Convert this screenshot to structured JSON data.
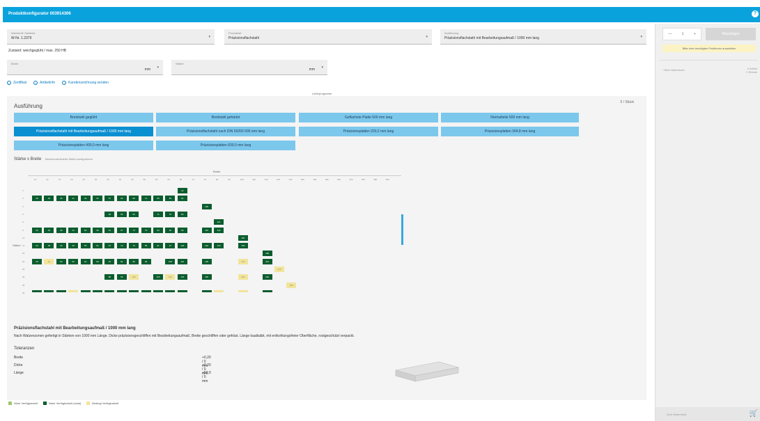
{
  "app": {
    "title": "Produktkonfigurator 003914306",
    "help_icon": "question-icon"
  },
  "selectors": {
    "material": {
      "label": "Werkstoff / Material",
      "value": "W-Nr. 1.2379"
    },
    "product": {
      "label": "Produktart",
      "value": "Präzisionsflachstahl"
    },
    "design": {
      "label": "Ausführung",
      "value": "Präzisionsflachstahl mit Bearbeitungsaufmaß / 1000 mm lang"
    },
    "width": {
      "label": "Breite",
      "unit": "mm"
    },
    "thickness": {
      "label": "Stärke",
      "unit": "mm"
    }
  },
  "state_note": "Zustand: weichgeglüht / max. 250 HB",
  "links": [
    "Zertifikat",
    "Artikelinfo",
    "Kundenzeichnung senden"
  ],
  "tab_caption": "Lieferprogramm",
  "card": {
    "heading": "Ausführung",
    "unit_toggle": "€ / Stück",
    "options": [
      "Breitstahl geglüht",
      "Breitstahl gehärtet",
      "Geflachste Platte 500 mm lang",
      "Normalteile 500 mm lang",
      "Präzisionsflachstahl mit Bearbeitungsaufmaß / 1000 mm lang",
      "Präzisionsflachstahl nach DIN 59200 500 mm lang",
      "Präzisionsplatten 203,2 mm lang",
      "Präzisionsplatten 304,8 mm lang",
      "Präzisionsplatten 400,0 mm lang",
      "Präzisionsplatten 600,0 mm lang"
    ],
    "active_option_index": 4,
    "grid_title": "Stärke x Breite",
    "grid_subtitle": "Benutzerdefinierte Maße konfigurieren",
    "col_axis": "Breite",
    "row_axis": "Stärke",
    "columns": [
      "10",
      "12",
      "15",
      "20",
      "25",
      "30",
      "35",
      "40",
      "45",
      "50",
      "55",
      "60",
      "65",
      "70",
      "75",
      "80",
      "90",
      "100",
      "110",
      "120",
      "130",
      "140",
      "150",
      "160",
      "180",
      "200",
      "220",
      "250",
      "280",
      "300"
    ],
    "rows": [
      "2",
      "3",
      "4",
      "5",
      "6",
      "8",
      "10",
      "12",
      "15",
      "20",
      "25",
      "30",
      "35",
      "40"
    ],
    "cells": [
      {
        "r": 0,
        "c": 12,
        "t": "d",
        "v": "12"
      },
      {
        "r": 1,
        "c": 0,
        "t": "d",
        "v": "28"
      },
      {
        "r": 1,
        "c": 1,
        "t": "d",
        "v": "29"
      },
      {
        "r": 1,
        "c": 2,
        "t": "d",
        "v": "35"
      },
      {
        "r": 1,
        "c": 3,
        "t": "d",
        "v": "41"
      },
      {
        "r": 1,
        "c": 4,
        "t": "d",
        "v": "46"
      },
      {
        "r": 1,
        "c": 5,
        "t": "d",
        "v": "52"
      },
      {
        "r": 1,
        "c": 6,
        "t": "d",
        "v": "57"
      },
      {
        "r": 1,
        "c": 7,
        "t": "d",
        "v": "63"
      },
      {
        "r": 1,
        "c": 8,
        "t": "d",
        "v": "68"
      },
      {
        "r": 1,
        "c": 9,
        "t": "d",
        "v": "74"
      },
      {
        "r": 1,
        "c": 10,
        "t": "d",
        "v": "80"
      },
      {
        "r": 1,
        "c": 11,
        "t": "d",
        "v": "85"
      },
      {
        "r": 1,
        "c": 12,
        "t": "d",
        "v": "91"
      },
      {
        "r": 2,
        "c": 14,
        "t": "d",
        "v": "105"
      },
      {
        "r": 3,
        "c": 6,
        "t": "d",
        "v": "48"
      },
      {
        "r": 3,
        "c": 7,
        "t": "d",
        "v": "53"
      },
      {
        "r": 3,
        "c": 8,
        "t": "d",
        "v": "59"
      },
      {
        "r": 3,
        "c": 10,
        "t": "d",
        "v": "71"
      },
      {
        "r": 3,
        "c": 11,
        "t": "d",
        "v": "76"
      },
      {
        "r": 3,
        "c": 12,
        "t": "d",
        "v": "82"
      },
      {
        "r": 4,
        "c": 15,
        "t": "d",
        "v": "121"
      },
      {
        "r": 5,
        "c": 0,
        "t": "d",
        "v": "30"
      },
      {
        "r": 5,
        "c": 1,
        "t": "d",
        "v": "33"
      },
      {
        "r": 5,
        "c": 2,
        "t": "d",
        "v": "38"
      },
      {
        "r": 5,
        "c": 3,
        "t": "d",
        "v": "44"
      },
      {
        "r": 5,
        "c": 4,
        "t": "d",
        "v": "50"
      },
      {
        "r": 5,
        "c": 5,
        "t": "d",
        "v": "56"
      },
      {
        "r": 5,
        "c": 6,
        "t": "d",
        "v": "61"
      },
      {
        "r": 5,
        "c": 7,
        "t": "d",
        "v": "67"
      },
      {
        "r": 5,
        "c": 8,
        "t": "d",
        "v": "73"
      },
      {
        "r": 5,
        "c": 9,
        "t": "d",
        "v": "79"
      },
      {
        "r": 5,
        "c": 10,
        "t": "d",
        "v": "84"
      },
      {
        "r": 5,
        "c": 11,
        "t": "d",
        "v": "90"
      },
      {
        "r": 5,
        "c": 12,
        "t": "d",
        "v": "96"
      },
      {
        "r": 5,
        "c": 14,
        "t": "d",
        "v": "115"
      },
      {
        "r": 5,
        "c": 15,
        "t": "d",
        "v": "126"
      },
      {
        "r": 6,
        "c": 17,
        "t": "d",
        "v": "150"
      },
      {
        "r": 7,
        "c": 0,
        "t": "d",
        "v": "34"
      },
      {
        "r": 7,
        "c": 1,
        "t": "d",
        "v": "38"
      },
      {
        "r": 7,
        "c": 2,
        "t": "d",
        "v": "43"
      },
      {
        "r": 7,
        "c": 3,
        "t": "d",
        "v": "49"
      },
      {
        "r": 7,
        "c": 4,
        "t": "d",
        "v": "55"
      },
      {
        "r": 7,
        "c": 5,
        "t": "d",
        "v": "61"
      },
      {
        "r": 7,
        "c": 6,
        "t": "d",
        "v": "67"
      },
      {
        "r": 7,
        "c": 7,
        "t": "d",
        "v": "73"
      },
      {
        "r": 7,
        "c": 8,
        "t": "d",
        "v": "79"
      },
      {
        "r": 7,
        "c": 9,
        "t": "d",
        "v": "85"
      },
      {
        "r": 7,
        "c": 10,
        "t": "d",
        "v": "91"
      },
      {
        "r": 7,
        "c": 11,
        "t": "d",
        "v": "97"
      },
      {
        "r": 7,
        "c": 12,
        "t": "d",
        "v": "103"
      },
      {
        "r": 7,
        "c": 14,
        "t": "d",
        "v": "122"
      },
      {
        "r": 7,
        "c": 15,
        "t": "d",
        "v": "134"
      },
      {
        "r": 7,
        "c": 17,
        "t": "d",
        "v": "159"
      },
      {
        "r": 8,
        "c": 19,
        "t": "d",
        "v": "186"
      },
      {
        "r": 9,
        "c": 0,
        "t": "d",
        "v": "40"
      },
      {
        "r": 9,
        "c": 1,
        "t": "y",
        "v": "44"
      },
      {
        "r": 9,
        "c": 2,
        "t": "d",
        "v": "50"
      },
      {
        "r": 9,
        "c": 3,
        "t": "d",
        "v": "56"
      },
      {
        "r": 9,
        "c": 4,
        "t": "d",
        "v": "63"
      },
      {
        "r": 9,
        "c": 5,
        "t": "d",
        "v": "69"
      },
      {
        "r": 9,
        "c": 6,
        "t": "d",
        "v": "76"
      },
      {
        "r": 9,
        "c": 7,
        "t": "d",
        "v": "82"
      },
      {
        "r": 9,
        "c": 8,
        "t": "d",
        "v": "89"
      },
      {
        "r": 9,
        "c": 9,
        "t": "d",
        "v": "95"
      },
      {
        "r": 9,
        "c": 11,
        "t": "d",
        "v": "108"
      },
      {
        "r": 9,
        "c": 12,
        "t": "d",
        "v": "115"
      },
      {
        "r": 9,
        "c": 14,
        "t": "d",
        "v": "135"
      },
      {
        "r": 9,
        "c": 17,
        "t": "y",
        "v": "175"
      },
      {
        "r": 9,
        "c": 19,
        "t": "d",
        "v": "201"
      },
      {
        "r": 10,
        "c": 20,
        "t": "y",
        "v": "219"
      },
      {
        "r": 11,
        "c": 6,
        "t": "d",
        "v": "88"
      },
      {
        "r": 11,
        "c": 7,
        "t": "d",
        "v": "95"
      },
      {
        "r": 11,
        "c": 8,
        "t": "y",
        "v": "103"
      },
      {
        "r": 11,
        "c": 10,
        "t": "d",
        "v": "118"
      },
      {
        "r": 11,
        "c": 11,
        "t": "y",
        "v": "126"
      },
      {
        "r": 11,
        "c": 12,
        "t": "d",
        "v": "133"
      },
      {
        "r": 11,
        "c": 14,
        "t": "d",
        "v": "156"
      },
      {
        "r": 11,
        "c": 17,
        "t": "y",
        "v": "200"
      },
      {
        "r": 11,
        "c": 19,
        "t": "d",
        "v": "230"
      },
      {
        "r": 12,
        "c": 21,
        "t": "y",
        "v": "252"
      },
      {
        "r": 13,
        "c": 0,
        "t": "d",
        "v": ""
      },
      {
        "r": 13,
        "c": 1,
        "t": "d",
        "v": ""
      },
      {
        "r": 13,
        "c": 2,
        "t": "d",
        "v": ""
      },
      {
        "r": 13,
        "c": 3,
        "t": "y",
        "v": ""
      },
      {
        "r": 13,
        "c": 4,
        "t": "d",
        "v": ""
      },
      {
        "r": 13,
        "c": 5,
        "t": "d",
        "v": ""
      },
      {
        "r": 13,
        "c": 6,
        "t": "d",
        "v": ""
      },
      {
        "r": 13,
        "c": 7,
        "t": "d",
        "v": ""
      },
      {
        "r": 13,
        "c": 8,
        "t": "d",
        "v": ""
      },
      {
        "r": 13,
        "c": 9,
        "t": "d",
        "v": ""
      },
      {
        "r": 13,
        "c": 10,
        "t": "d",
        "v": ""
      },
      {
        "r": 13,
        "c": 11,
        "t": "d",
        "v": ""
      },
      {
        "r": 13,
        "c": 12,
        "t": "d",
        "v": ""
      },
      {
        "r": 13,
        "c": 14,
        "t": "d",
        "v": ""
      },
      {
        "r": 13,
        "c": 15,
        "t": "y",
        "v": ""
      },
      {
        "r": 13,
        "c": 17,
        "t": "y",
        "v": ""
      },
      {
        "r": 13,
        "c": 19,
        "t": "d",
        "v": ""
      }
    ],
    "description_title": "Präzisionsflachstahl mit Bearbeitungsaufmaß / 1000 mm lang",
    "description_text": "Nach Walzenzonen gefertigt in Stärken von 1000 mm Länge. Dicke präzisionsgeschliffen mit Bearbeitungsaufmaß, Breite geschliffen oder gefräst. Länge kaaltsäbt, mit entkohlungsfreier Oberfläche, rostgeschützt verpackt.",
    "tolerance_title": "Toleranzen",
    "tolerances": [
      {
        "name": "Breite",
        "value": "+0,20 / 0 mm"
      },
      {
        "name": "Dicke",
        "value": "+0,20 / 0 mm"
      },
      {
        "name": "Länge",
        "value": "+59,0 / 0 mm"
      }
    ]
  },
  "legend": [
    {
      "label": "Ware Verfügbarkeit",
      "color": "#9bc86b"
    },
    {
      "label": "Ware Verfügbarkeit (lokal)",
      "color": "#0b5d2e"
    },
    {
      "label": "Bedingt Verfügbarkeit",
      "color": "#f1e49b"
    }
  ],
  "sidebar": {
    "qty_minus": "—",
    "qty_value": "1",
    "qty_plus": "+",
    "cart_button": "Hinzufügen",
    "hint": "Bitte eine benötigten Positionen auswählen",
    "watchlist": "Mein Warenkorb",
    "watchlist_count": "0 Artikel",
    "watchlist_sum": "0 Stücke",
    "to_cart": "Zum Warenkorb"
  },
  "colors": {
    "accent": "#0aa2dd",
    "option": "#7cc7ec",
    "option_active": "#0a8fd1",
    "cell_dark": "#0b5d2e",
    "cell_yellow": "#f1e49b"
  }
}
